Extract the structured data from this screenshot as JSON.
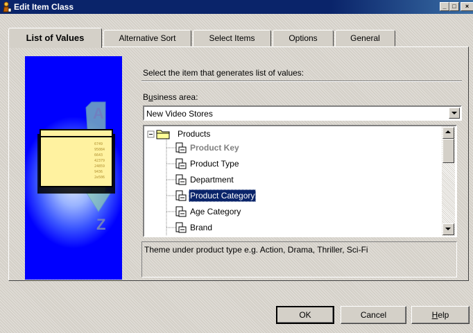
{
  "window": {
    "title": "Edit Item Class",
    "controls": {
      "minimize": "_",
      "maximize": "□",
      "close": "×"
    }
  },
  "tabs": [
    {
      "label": "List of Values",
      "active": true
    },
    {
      "label": "Alternative Sort",
      "active": false
    },
    {
      "label": "Select Items",
      "active": false
    },
    {
      "label": "Options",
      "active": false
    },
    {
      "label": "General",
      "active": false
    }
  ],
  "main": {
    "instruction": "Select the item that generates list of values:",
    "business_area_label": "Business area:",
    "business_area_value": "New Video Stores",
    "tree": [
      {
        "label": "Products",
        "kind": "folder",
        "expanded": true
      },
      {
        "label": "Product Key",
        "kind": "item",
        "style": "bold-grey"
      },
      {
        "label": "Product Type",
        "kind": "item"
      },
      {
        "label": "Department",
        "kind": "item"
      },
      {
        "label": "Product Category",
        "kind": "item",
        "selected": true
      },
      {
        "label": "Age Category",
        "kind": "item"
      },
      {
        "label": "Brand",
        "kind": "item"
      }
    ],
    "description": "Theme under product type e.g. Action, Drama, Thriller, Sci-Fi"
  },
  "art": {
    "letter_top": "A",
    "letter_bottom": "Z",
    "sample_numbers": [
      "6749",
      "95084",
      "6643",
      "42379",
      "24859",
      "9436",
      "2e506"
    ]
  },
  "buttons": {
    "ok": "OK",
    "cancel": "Cancel",
    "help": "Help"
  },
  "colors": {
    "titlebar": "#0a246a",
    "selection": "#0a246a",
    "art_blue": "#0000ff",
    "face": "#d4d0c8"
  }
}
